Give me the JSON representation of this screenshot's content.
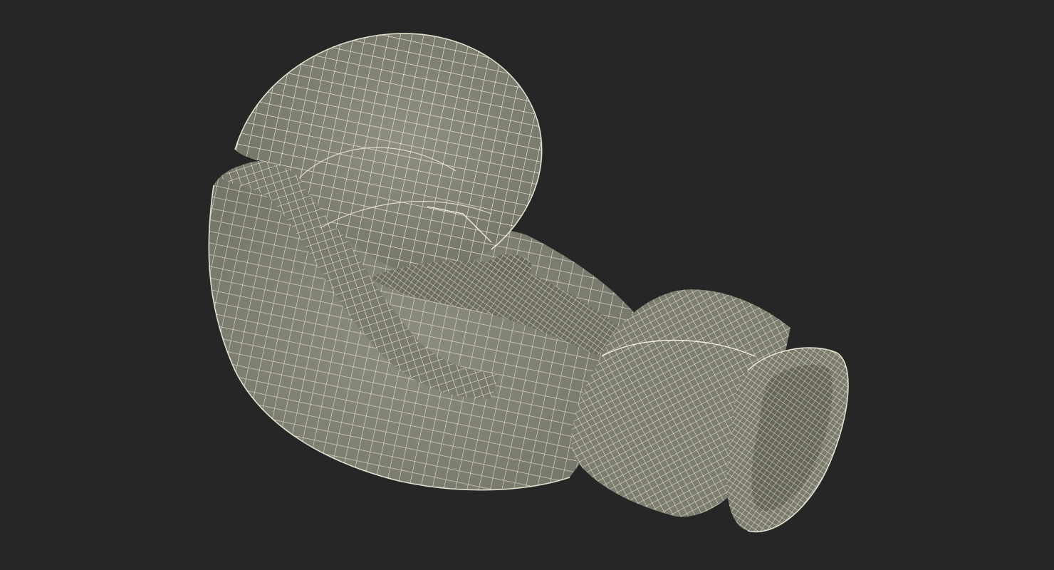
{
  "scene": {
    "subject_icon": "boxing-glove-wireframe",
    "colors": {
      "background": "#262626",
      "surface": "#858577",
      "surface_shadow": "#6f6f63",
      "surface_highlight": "#8f8f82",
      "wire": "#f1efdd"
    }
  }
}
